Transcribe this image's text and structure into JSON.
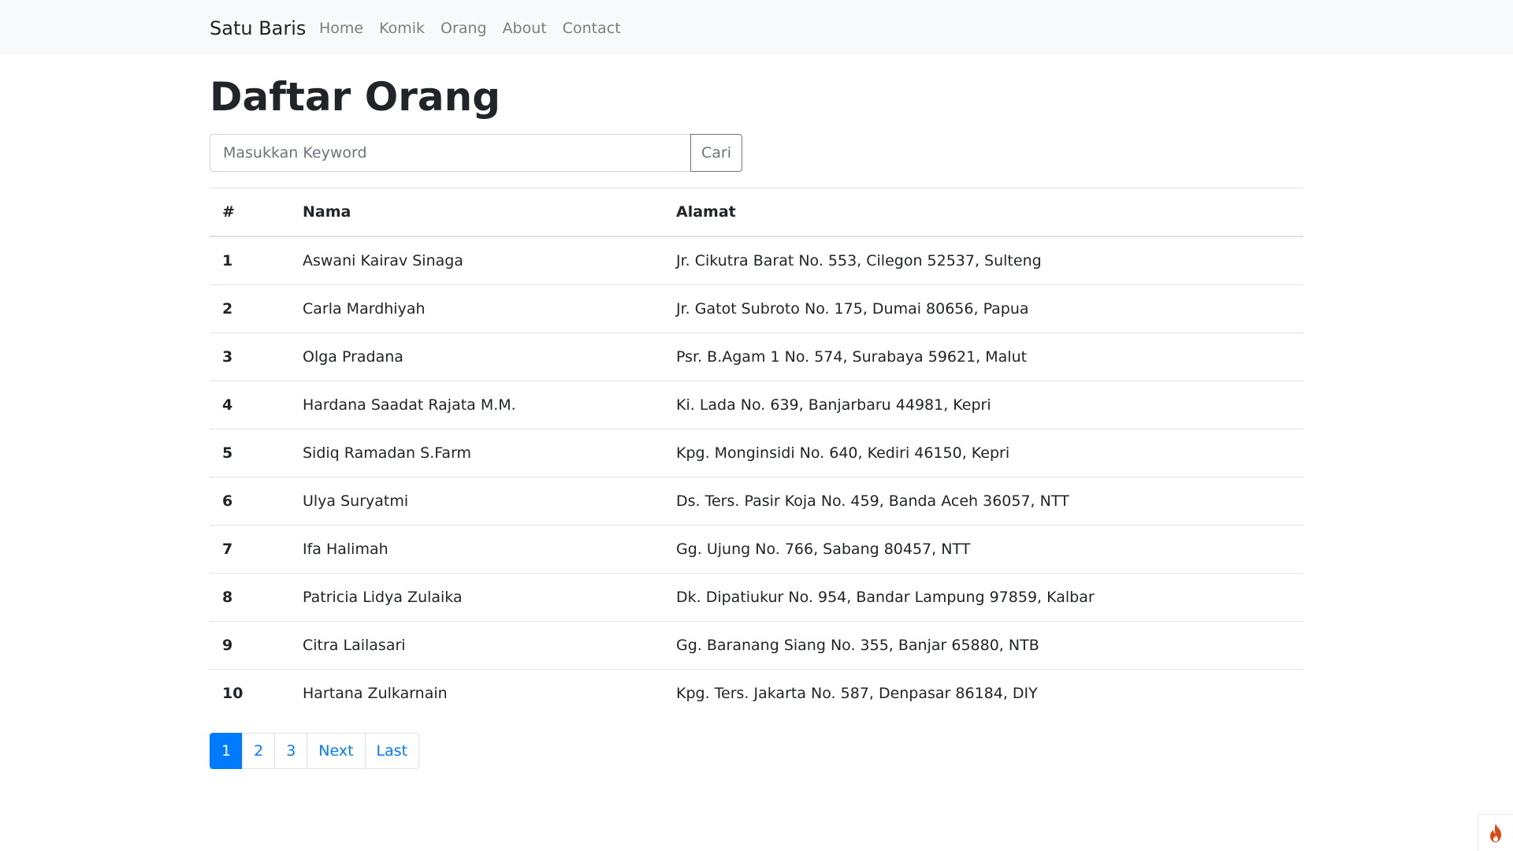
{
  "navbar": {
    "brand": "Satu Baris",
    "links": [
      {
        "label": "Home",
        "active": true
      },
      {
        "label": "Komik",
        "active": false
      },
      {
        "label": "Orang",
        "active": false
      },
      {
        "label": "About",
        "active": false
      },
      {
        "label": "Contact",
        "active": false
      }
    ]
  },
  "page_title": "Daftar Orang",
  "search": {
    "placeholder": "Masukkan Keyword",
    "value": "",
    "button_label": "Cari"
  },
  "table": {
    "headers": [
      "#",
      "Nama",
      "Alamat"
    ],
    "rows": [
      {
        "num": "1",
        "nama": "Aswani Kairav Sinaga",
        "alamat": "Jr. Cikutra Barat No. 553, Cilegon 52537, Sulteng"
      },
      {
        "num": "2",
        "nama": "Carla Mardhiyah",
        "alamat": "Jr. Gatot Subroto No. 175, Dumai 80656, Papua"
      },
      {
        "num": "3",
        "nama": "Olga Pradana",
        "alamat": "Psr. B.Agam 1 No. 574, Surabaya 59621, Malut"
      },
      {
        "num": "4",
        "nama": "Hardana Saadat Rajata M.M.",
        "alamat": "Ki. Lada No. 639, Banjarbaru 44981, Kepri"
      },
      {
        "num": "5",
        "nama": "Sidiq Ramadan S.Farm",
        "alamat": "Kpg. Monginsidi No. 640, Kediri 46150, Kepri"
      },
      {
        "num": "6",
        "nama": "Ulya Suryatmi",
        "alamat": "Ds. Ters. Pasir Koja No. 459, Banda Aceh 36057, NTT"
      },
      {
        "num": "7",
        "nama": "Ifa Halimah",
        "alamat": "Gg. Ujung No. 766, Sabang 80457, NTT"
      },
      {
        "num": "8",
        "nama": "Patricia Lidya Zulaika",
        "alamat": "Dk. Dipatiukur No. 954, Bandar Lampung 97859, Kalbar"
      },
      {
        "num": "9",
        "nama": "Citra Lailasari",
        "alamat": "Gg. Baranang Siang No. 355, Banjar 65880, NTB"
      },
      {
        "num": "10",
        "nama": "Hartana Zulkarnain",
        "alamat": "Kpg. Ters. Jakarta No. 587, Denpasar 86184, DIY"
      }
    ]
  },
  "pagination": {
    "items": [
      {
        "label": "1",
        "active": true
      },
      {
        "label": "2",
        "active": false
      },
      {
        "label": "3",
        "active": false
      },
      {
        "label": "Next",
        "active": false
      },
      {
        "label": "Last",
        "active": false
      }
    ]
  },
  "colors": {
    "primary": "#007bff",
    "navbar_bg": "#f8f9fa",
    "text": "#212529",
    "muted": "#6c757d",
    "flame": "#dd4814"
  },
  "icons": {
    "debug_toolbar": "flame-icon"
  }
}
